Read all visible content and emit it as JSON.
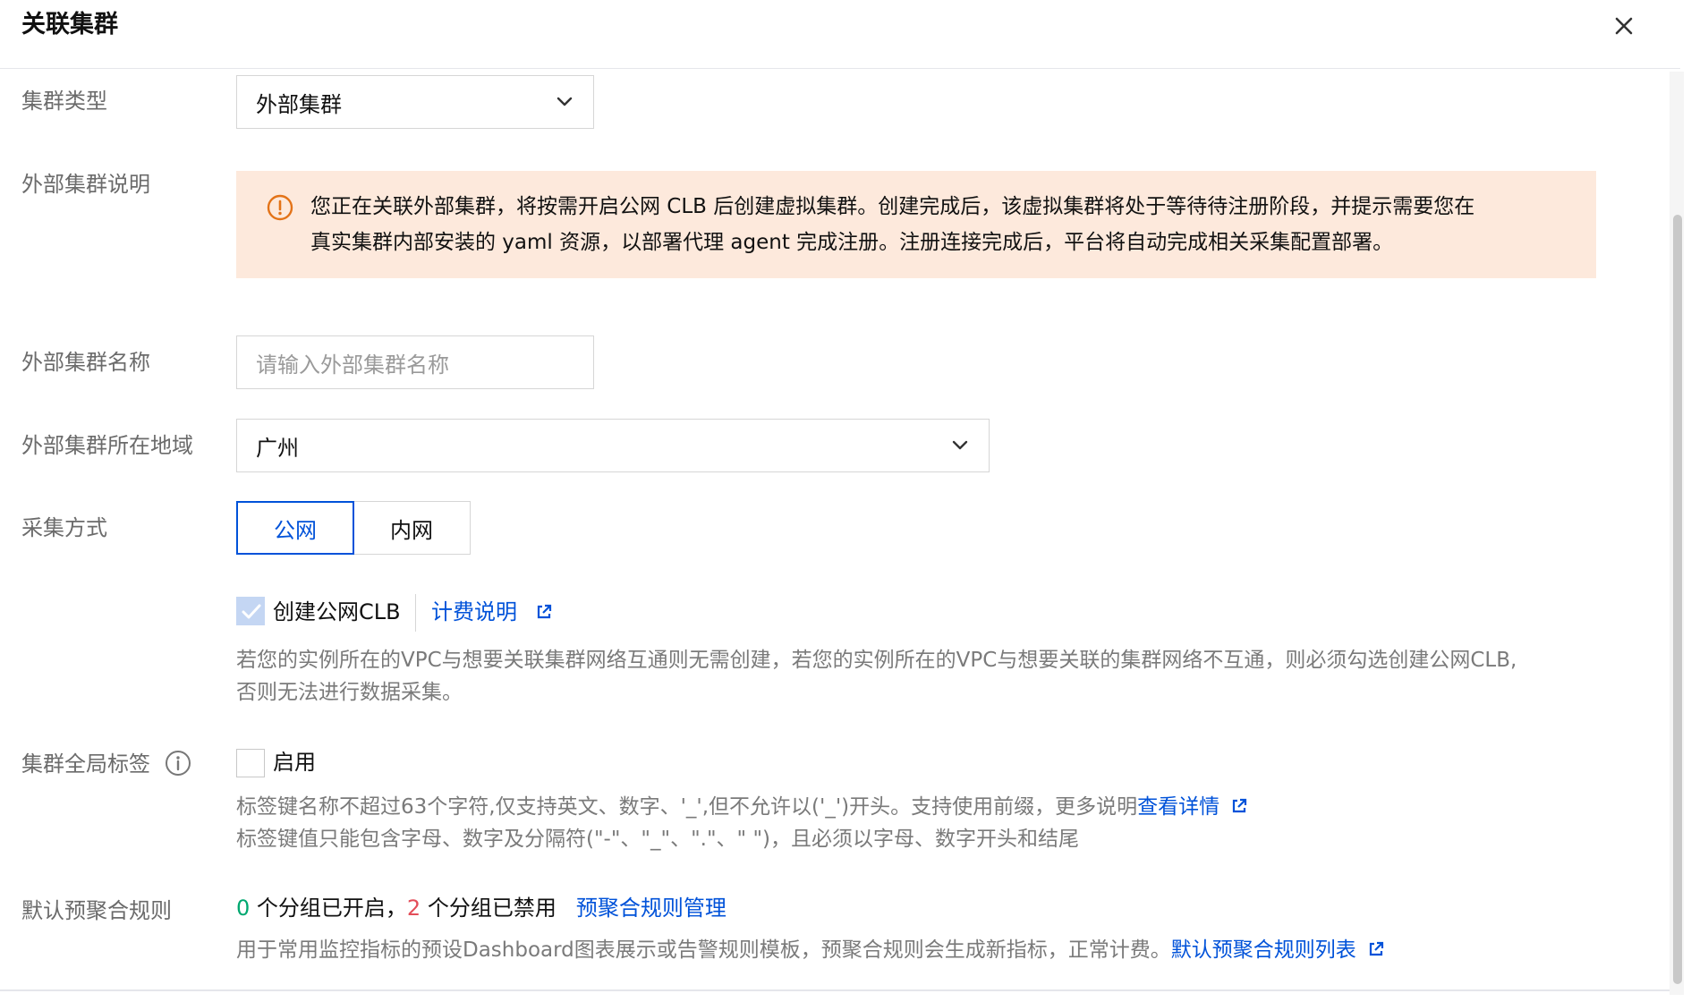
{
  "dialog": {
    "title": "关联集群"
  },
  "form": {
    "cluster_type": {
      "label": "集群类型",
      "value": "外部集群"
    },
    "external_desc": {
      "label": "外部集群说明",
      "line1": "您正在关联外部集群，将按需开启公网 CLB 后创建虚拟集群。创建完成后，该虚拟集群将处于等待待注册阶段，并提示需要您在",
      "line2": "真实集群内部安装的 yaml 资源，以部署代理 agent 完成注册。注册连接完成后，平台将自动完成相关采集配置部署。"
    },
    "cluster_name": {
      "label": "外部集群名称",
      "placeholder": "请输入外部集群名称"
    },
    "cluster_region": {
      "label": "外部集群所在地域",
      "value": "广州"
    },
    "collect_mode": {
      "label": "采集方式",
      "options": [
        "公网",
        "内网"
      ],
      "selected": "公网"
    },
    "create_clb": {
      "label": "创建公网CLB",
      "checked": true,
      "billing_link": "计费说明",
      "help_line1": "若您的实例所在的VPC与想要关联集群网络互通则无需创建，若您的实例所在的VPC与想要关联的集群网络不互通，则必须勾选创建公网CLB,",
      "help_line2": "否则无法进行数据采集。"
    },
    "global_tags": {
      "label": "集群全局标签",
      "enable_label": "启用",
      "checked": false,
      "help_line1": "标签键名称不超过63个字符,仅支持英文、数字、'_',但不允许以('_')开头。支持使用前缀，更多说明",
      "help_link": "查看详情",
      "help_line2": "标签键值只能包含字母、数字及分隔符(\"-\"、\"_\"、\".\"、\" \")，且必须以字母、数字开头和结尾"
    },
    "default_rules": {
      "label": "默认预聚合规则",
      "enabled_count": "0",
      "enabled_text": " 个分组已开启，",
      "disabled_count": "2",
      "disabled_text": " 个分组已禁用",
      "manage_link": "预聚合规则管理",
      "help_text": "用于常用监控指标的预设Dashboard图表展示或告警规则模板，预聚合规则会生成新指标，正常计费。",
      "help_link": "默认预聚合规则列表"
    }
  },
  "colors": {
    "accent": "#0052d9",
    "warning_bg": "#fde9dc",
    "warning_icon": "#e37318",
    "success": "#00a870",
    "danger": "#e34d59"
  },
  "icons": {
    "close": "close-icon",
    "chevron": "chevron-down-icon",
    "warning": "warning-circle-icon",
    "external": "external-link-icon",
    "info": "info-circle-icon",
    "check": "check-icon"
  }
}
